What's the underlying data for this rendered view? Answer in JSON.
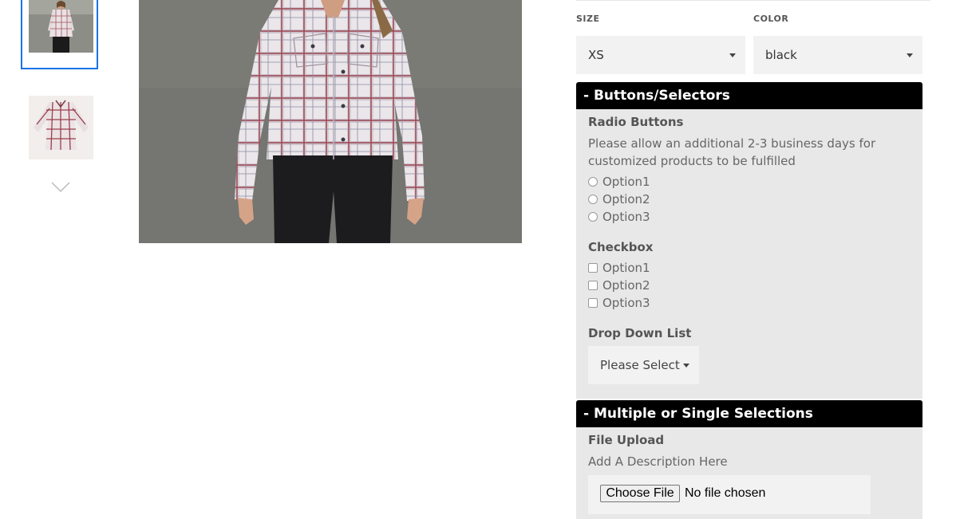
{
  "product_options": {
    "size": {
      "label": "SIZE",
      "value": "XS"
    },
    "color": {
      "label": "COLOR",
      "value": "black"
    }
  },
  "sections": {
    "buttons_selectors": {
      "header": "- Buttons/Selectors",
      "radio": {
        "title": "Radio Buttons",
        "help": "Please allow an additional 2-3 business days for customized products to be fulfilled",
        "options": [
          "Option1",
          "Option2",
          "Option3"
        ]
      },
      "checkbox": {
        "title": "Checkbox",
        "options": [
          "Option1",
          "Option2",
          "Option3"
        ]
      },
      "dropdown": {
        "title": "Drop Down List",
        "value": "Please Select"
      }
    },
    "multiple_single": {
      "header": "- Multiple or Single Selections",
      "file_upload": {
        "title": "File Upload",
        "help": "Add A Description Here",
        "button_label": "Choose File",
        "status": "No file chosen"
      }
    }
  },
  "colors": {
    "thumb_active_border": "#1a73e8",
    "section_header_bg": "#000000",
    "panel_bg": "#e8e8e8",
    "select_bg": "#f2f2f2"
  },
  "icons": {
    "thumbnail_scroll": "chevron-down-icon",
    "select_caret": "caret-down-icon"
  }
}
